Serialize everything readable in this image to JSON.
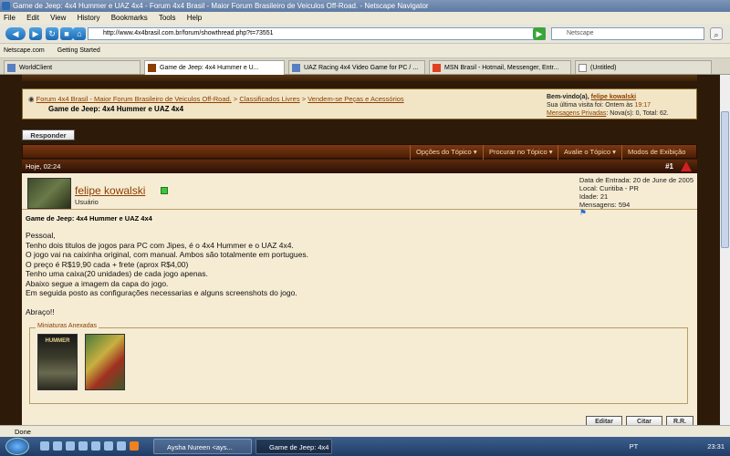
{
  "window": {
    "title": "Game de Jeep: 4x4 Hummer e UAZ 4x4 - Forum 4x4 Brasil - Maior Forum Brasileiro de Veiculos Off-Road. - Netscape Navigator"
  },
  "menu": [
    "File",
    "Edit",
    "View",
    "History",
    "Bookmarks",
    "Tools",
    "Help"
  ],
  "nav": {
    "url": "http://www.4x4brasil.com.br/forum/showthread.php?t=73551",
    "search_placeholder": "Netscape"
  },
  "bookmarks": [
    "Netscape.com",
    "Getting Started"
  ],
  "tabs": [
    {
      "label": "WorldClient"
    },
    {
      "label": "Game de Jeep: 4x4 Hummer e U..."
    },
    {
      "label": "UAZ Racing 4x4 Video Game for PC / ..."
    },
    {
      "label": "MSN Brasil - Hotmail, Messenger, Entr..."
    },
    {
      "label": "(Untitled)"
    }
  ],
  "forum": {
    "breadcrumb": {
      "root": "Forum 4x4 Brasil - Maior Forum Brasileiro de Veiculos Off-Road.",
      "sep": ">",
      "c1": "Classificados Livres",
      "c2": "Vendem-se Peças e Acessórios",
      "thread_title": "Game de Jeep: 4x4 Hummer e UAZ 4x4"
    },
    "welcome": {
      "greeting": "Bem-vindo(a),",
      "username": "felipe kowalski",
      "last_visit_label": "Sua última visita foi: Ontem às",
      "last_visit_time": "19:17",
      "pm_label": "Mensagens Privadas",
      "pm_stats": ": Nova(s): 0, Total: 62."
    },
    "reply_button": "Responder",
    "tools": [
      "Opções do Tópico ▾",
      "Procurar no Tópico ▾",
      "Avalie o Tópico ▾",
      "Modos de Exibição ▾"
    ],
    "post": {
      "date": "Hoje, 02:24",
      "number": "#1",
      "author": "felipe kowalski",
      "author_title": "Usuário",
      "info": {
        "join": "Data de Entrada: 20 de June de 2005",
        "location": "Local: Curitiba - PR",
        "age": "Idade: 21",
        "posts": "Mensagens: 594"
      },
      "subject": "Game de Jeep: 4x4 Hummer e UAZ 4x4",
      "body": [
        "Pessoal,",
        "Tenho dois titulos de jogos para PC com Jipes, é o 4x4 Hummer e o UAZ 4x4.",
        "O jogo vai na caixinha original, com manual. Ambos são totalmente em portugues.",
        "O preço é R$19,90 cada + frete (aprox R$4,00)",
        "Tenho uma caixa(20 unidades) de cada jogo apenas.",
        "Abaixo segue a imagem da capa do jogo.",
        "Em seguida posto as configurações necessarias e alguns screenshots do jogo.",
        "",
        "Abraço!!"
      ],
      "attachments_label": "Miniaturas Anexadas",
      "thumb1_text": "HUMMER",
      "buttons": [
        "Editar",
        "Citar",
        "R.R."
      ]
    }
  },
  "status": "Done",
  "taskbar": {
    "items": [
      "Aysha Nureen <ays...",
      "Game de Jeep: 4x4 ..."
    ],
    "lang": "PT",
    "time": "23:31"
  }
}
